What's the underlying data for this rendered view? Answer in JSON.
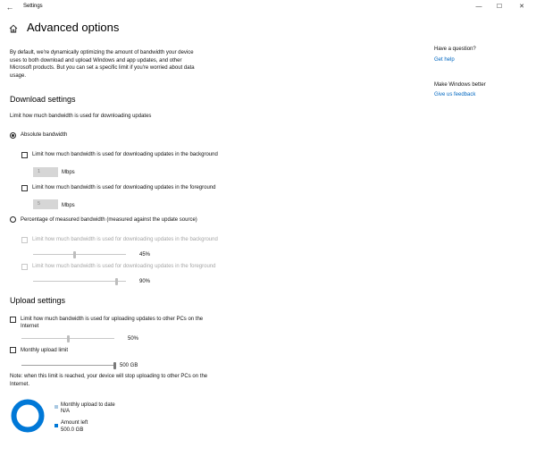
{
  "window": {
    "title": "Settings",
    "back_icon": "back-arrow-icon",
    "controls": {
      "minimize": "—",
      "maximize": "☐",
      "close": "✕"
    }
  },
  "page": {
    "title": "Advanced options",
    "home_icon": "home-icon",
    "intro": "By default, we're dynamically optimizing the amount of bandwidth your device uses to both download and upload Windows and app updates, and other Microsoft products. But you can set a specific limit if you're worried about data usage."
  },
  "download": {
    "title": "Download settings",
    "subtitle": "Limit how much bandwidth is used for downloading updates",
    "absolute": {
      "label": "Absolute bandwidth",
      "selected": true,
      "background": {
        "label": "Limit how much bandwidth is used for downloading updates in the background",
        "checked": false,
        "value": "1",
        "unit": "Mbps"
      },
      "foreground": {
        "label": "Limit how much bandwidth is used for downloading updates in the foreground",
        "checked": false,
        "value": "5",
        "unit": "Mbps"
      }
    },
    "percentage": {
      "label": "Percentage of measured bandwidth (measured against the update source)",
      "selected": false,
      "background": {
        "label": "Limit how much bandwidth is used for downloading updates in the background",
        "checked": false,
        "value": 45,
        "value_label": "45%"
      },
      "foreground": {
        "label": "Limit how much bandwidth is used for downloading updates in the foreground",
        "checked": false,
        "value": 90,
        "value_label": "90%"
      }
    }
  },
  "upload": {
    "title": "Upload settings",
    "limit": {
      "label_line1": "Limit how much bandwidth is used for uploading updates to other PCs on the",
      "label_line2": "Internet",
      "checked": false,
      "value": 50,
      "value_label": "50%"
    },
    "monthly": {
      "label": "Monthly upload limit",
      "checked": false,
      "value": 500,
      "max": 500,
      "value_label": "500 GB"
    },
    "note": "Note: when this limit is reached, your device will stop uploading to other PCs on the Internet.",
    "usage": {
      "uploaded_label": "Monthly upload to date",
      "uploaded_value": "N/A",
      "left_label": "Amount left",
      "left_value": "500.0 GB",
      "uploaded_color": "#a9c8e2",
      "left_color": "#0078d7"
    }
  },
  "sidebar": {
    "question": "Have a question?",
    "help_link": "Get help",
    "improve": "Make Windows better",
    "feedback_link": "Give us feedback"
  },
  "colors": {
    "accent": "#0078d7",
    "link": "#0067c0"
  }
}
